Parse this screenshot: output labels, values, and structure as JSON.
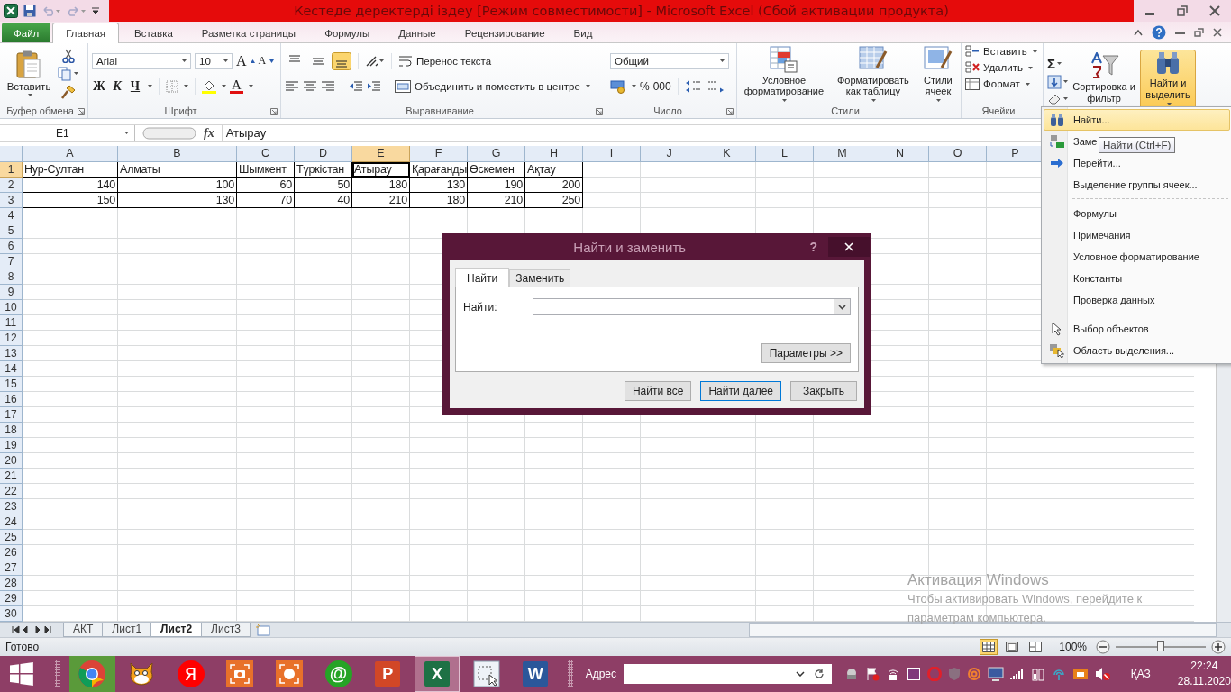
{
  "window": {
    "title": "Кестеде деректерді іздеу  [Режим совместимости]  -  Microsoft Excel (Сбой активации продукта)"
  },
  "ribbon_tabs": [
    {
      "label": "Файл",
      "kind": "file",
      "selected": false
    },
    {
      "label": "Главная",
      "kind": "tab",
      "selected": true
    },
    {
      "label": "Вставка",
      "kind": "tab",
      "selected": false
    },
    {
      "label": "Разметка страницы",
      "kind": "tab",
      "selected": false
    },
    {
      "label": "Формулы",
      "kind": "tab",
      "selected": false
    },
    {
      "label": "Данные",
      "kind": "tab",
      "selected": false
    },
    {
      "label": "Рецензирование",
      "kind": "tab",
      "selected": false
    },
    {
      "label": "Вид",
      "kind": "tab",
      "selected": false
    }
  ],
  "ribbon": {
    "clipboard": {
      "title": "Буфер обмена",
      "paste": "Вставить"
    },
    "font": {
      "title": "Шрифт",
      "family": "Arial",
      "size": "10",
      "grow": "A",
      "shrink": "A",
      "bold": "Ж",
      "italic": "К",
      "underline": "Ч",
      "color_glyph": "A"
    },
    "alignment": {
      "title": "Выравнивание",
      "vertical": [
        {
          "selected": false
        },
        {
          "selected": false
        },
        {
          "selected": true
        }
      ],
      "wrap": "Перенос текста",
      "merge": "Объединить и поместить в центре"
    },
    "number": {
      "title": "Число",
      "format": "Общий",
      "percent": "%",
      "thousands": "000"
    },
    "styles": {
      "title": "Стили",
      "buttons": [
        {
          "kind": "conditional",
          "label": "Условное форматирование"
        },
        {
          "kind": "table",
          "label": "Форматировать как таблицу"
        },
        {
          "kind": "cell",
          "label": "Стили ячеек"
        }
      ]
    },
    "cells": {
      "title": "Ячейки",
      "buttons": [
        {
          "kind": "insert",
          "label": "Вставить"
        },
        {
          "kind": "delete",
          "label": "Удалить"
        },
        {
          "kind": "format",
          "label": "Формат"
        }
      ]
    },
    "editing": {
      "sum": "Σ",
      "sort": "Сортировка и фильтр",
      "find": "Найти и выделить",
      "find_open": true
    }
  },
  "formula_bar": {
    "name_box": "E1",
    "fx": "fx",
    "value": "Атырау"
  },
  "sheet": {
    "columns": [
      {
        "label": "A",
        "selected": false
      },
      {
        "label": "B",
        "selected": false
      },
      {
        "label": "C",
        "selected": false
      },
      {
        "label": "D",
        "selected": false
      },
      {
        "label": "E",
        "selected": true
      },
      {
        "label": "F",
        "selected": false
      },
      {
        "label": "G",
        "selected": false
      },
      {
        "label": "H",
        "selected": false
      },
      {
        "label": "I",
        "selected": false
      },
      {
        "label": "J",
        "selected": false
      },
      {
        "label": "K",
        "selected": false
      },
      {
        "label": "L",
        "selected": false
      },
      {
        "label": "M",
        "selected": false
      },
      {
        "label": "N",
        "selected": false
      },
      {
        "label": "O",
        "selected": false
      },
      {
        "label": "P",
        "selected": false
      }
    ],
    "rows": [
      {
        "label": "1",
        "selected": true,
        "cells": [
          {
            "value": "Нур-Султан",
            "kind": "text",
            "selected": false
          },
          {
            "value": "Алматы",
            "kind": "text",
            "selected": false
          },
          {
            "value": "Шымкент",
            "kind": "text",
            "selected": false
          },
          {
            "value": "Түркістан",
            "kind": "text",
            "selected": false
          },
          {
            "value": "Атырау",
            "kind": "text",
            "selected": true
          },
          {
            "value": "Қарағанды",
            "kind": "text",
            "selected": false
          },
          {
            "value": "Өскемен",
            "kind": "text",
            "selected": false
          },
          {
            "value": "Ақтау",
            "kind": "text",
            "selected": false
          }
        ]
      },
      {
        "label": "2",
        "selected": false,
        "cells": [
          {
            "value": "140",
            "kind": "number",
            "selected": false
          },
          {
            "value": "100",
            "kind": "number",
            "selected": false
          },
          {
            "value": "60",
            "kind": "number",
            "selected": false
          },
          {
            "value": "50",
            "kind": "number",
            "selected": false
          },
          {
            "value": "180",
            "kind": "number",
            "selected": false
          },
          {
            "value": "130",
            "kind": "number",
            "selected": false
          },
          {
            "value": "190",
            "kind": "number",
            "selected": false
          },
          {
            "value": "200",
            "kind": "number",
            "selected": false
          }
        ]
      },
      {
        "label": "3",
        "selected": false,
        "cells": [
          {
            "value": "150",
            "kind": "number",
            "selected": false
          },
          {
            "value": "130",
            "kind": "number",
            "selected": false
          },
          {
            "value": "70",
            "kind": "number",
            "selected": false
          },
          {
            "value": "40",
            "kind": "number",
            "selected": false
          },
          {
            "value": "210",
            "kind": "number",
            "selected": false
          },
          {
            "value": "180",
            "kind": "number",
            "selected": false
          },
          {
            "value": "210",
            "kind": "number",
            "selected": false
          },
          {
            "value": "250",
            "kind": "number",
            "selected": false
          }
        ]
      },
      {
        "label": "4",
        "selected": false
      },
      {
        "label": "5",
        "selected": false
      },
      {
        "label": "6",
        "selected": false
      },
      {
        "label": "7",
        "selected": false
      },
      {
        "label": "8",
        "selected": false
      },
      {
        "label": "9",
        "selected": false
      },
      {
        "label": "10",
        "selected": false
      },
      {
        "label": "11",
        "selected": false
      },
      {
        "label": "12",
        "selected": false
      },
      {
        "label": "13",
        "selected": false
      },
      {
        "label": "14",
        "selected": false
      },
      {
        "label": "15",
        "selected": false
      },
      {
        "label": "16",
        "selected": false
      },
      {
        "label": "17",
        "selected": false
      },
      {
        "label": "18",
        "selected": false
      },
      {
        "label": "19",
        "selected": false
      },
      {
        "label": "20",
        "selected": false
      },
      {
        "label": "21",
        "selected": false
      },
      {
        "label": "22",
        "selected": false
      },
      {
        "label": "23",
        "selected": false
      },
      {
        "label": "24",
        "selected": false
      },
      {
        "label": "25",
        "selected": false
      },
      {
        "label": "26",
        "selected": false
      },
      {
        "label": "27",
        "selected": false
      },
      {
        "label": "28",
        "selected": false
      },
      {
        "label": "29",
        "selected": false
      },
      {
        "label": "30",
        "selected": false
      }
    ]
  },
  "sheet_tabs": [
    {
      "label": "АКТ",
      "selected": false
    },
    {
      "label": "Лист1",
      "selected": false
    },
    {
      "label": "Лист2",
      "selected": true
    },
    {
      "label": "Лист3",
      "selected": false
    }
  ],
  "status_bar": {
    "status": "Готово",
    "views": [
      {
        "kind": "normal",
        "selected": true
      },
      {
        "kind": "layout",
        "selected": false
      },
      {
        "kind": "pagebreak",
        "selected": false
      }
    ],
    "zoom": "100%",
    "zoom_slider": {
      "level": 0.5
    }
  },
  "dialog": {
    "title": "Найти и заменить",
    "help": "?",
    "tabs": [
      {
        "label": "Найти",
        "selected": true
      },
      {
        "label": "Заменить",
        "selected": false
      }
    ],
    "find_label": "Найти:",
    "options": "Параметры >>",
    "buttons": [
      {
        "label": "Найти все",
        "default": false
      },
      {
        "label": "Найти далее",
        "default": true
      },
      {
        "label": "Закрыть",
        "default": false
      }
    ]
  },
  "menu": {
    "sections": [
      {
        "items": [
          {
            "label": "Найти...",
            "kind": "find",
            "selected": true
          },
          {
            "label": "Заме",
            "kind": "replace",
            "selected": false
          },
          {
            "label": "Перейти...",
            "kind": "goto",
            "selected": false
          },
          {
            "label": "Выделение группы ячеек...",
            "kind": "plain",
            "selected": false
          }
        ]
      },
      {
        "items": [
          {
            "label": "Формулы",
            "kind": "plain",
            "selected": false
          },
          {
            "label": "Примечания",
            "kind": "plain",
            "selected": false
          },
          {
            "label": "Условное форматирование",
            "kind": "plain",
            "selected": false
          },
          {
            "label": "Константы",
            "kind": "plain",
            "selected": false
          },
          {
            "label": "Проверка данных",
            "kind": "plain",
            "selected": false
          }
        ]
      },
      {
        "items": [
          {
            "label": "Выбор объектов",
            "kind": "select",
            "selected": false
          },
          {
            "label": "Область выделения...",
            "kind": "pane",
            "selected": false
          }
        ]
      }
    ]
  },
  "tooltip": "Найти (Ctrl+F)",
  "activation_notice": {
    "title": "Активация Windows",
    "lines": [
      "Чтобы активировать Windows, перейдите к",
      "параметрам компьютера."
    ]
  },
  "taskbar": {
    "apps": [
      {
        "kind": "chrome",
        "active": false
      },
      {
        "kind": "scratch",
        "active": false
      },
      {
        "kind": "yandex",
        "glyph": "Я",
        "active": false
      },
      {
        "kind": "camera",
        "active": false
      },
      {
        "kind": "recorder",
        "active": false
      },
      {
        "kind": "mail",
        "glyph": "@",
        "active": false
      },
      {
        "kind": "powerpoint",
        "glyph": "P",
        "active": false
      },
      {
        "kind": "excel",
        "glyph": "X",
        "active": true
      },
      {
        "kind": "snip",
        "active": false
      },
      {
        "kind": "word",
        "glyph": "W",
        "active": false
      }
    ],
    "address_label": "Адрес",
    "language": "ҚАЗ",
    "time": "22:24",
    "date": "28.11.2020"
  }
}
